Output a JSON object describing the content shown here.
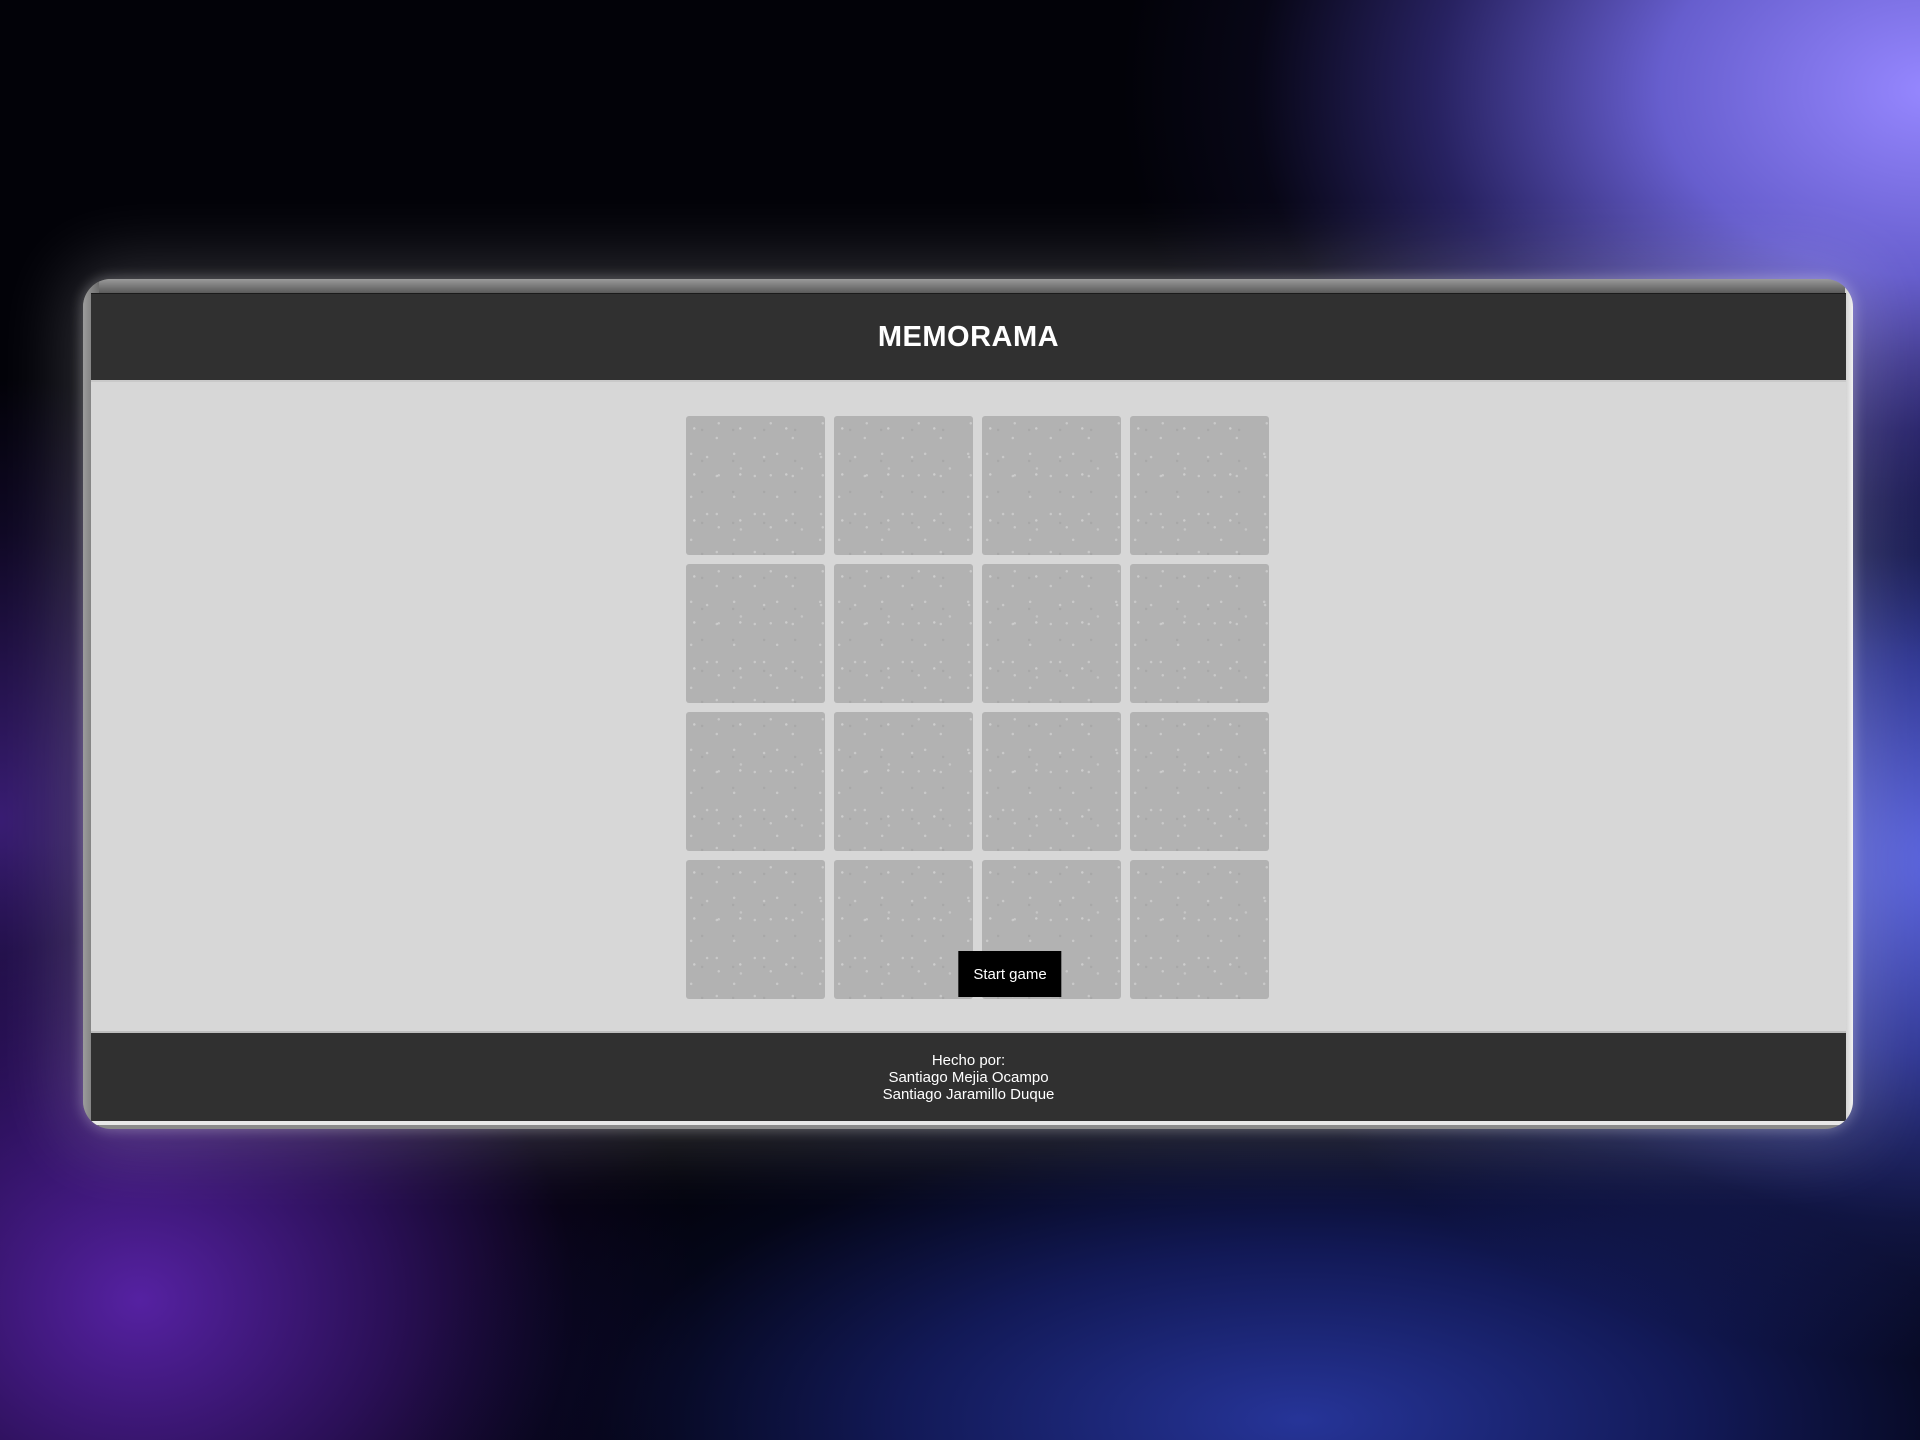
{
  "header": {
    "title": "MEMORAMA"
  },
  "board": {
    "rows": 4,
    "columns": 4,
    "cards": [
      {
        "state": "face-down"
      },
      {
        "state": "face-down"
      },
      {
        "state": "face-down"
      },
      {
        "state": "face-down"
      },
      {
        "state": "face-down"
      },
      {
        "state": "face-down"
      },
      {
        "state": "face-down"
      },
      {
        "state": "face-down"
      },
      {
        "state": "face-down"
      },
      {
        "state": "face-down"
      },
      {
        "state": "face-down"
      },
      {
        "state": "face-down"
      },
      {
        "state": "face-down"
      },
      {
        "state": "face-down"
      },
      {
        "state": "face-down"
      },
      {
        "state": "face-down"
      }
    ],
    "card_back_color": "#b2b2b2"
  },
  "start_button": {
    "label": "Start game"
  },
  "footer": {
    "made_by_label": "Hecho por:",
    "authors": [
      "Santiago Mejia Ocampo",
      "Santiago Jaramillo Duque"
    ]
  },
  "colors": {
    "header_bg": "#303030",
    "page_bg": "#d7d7d7",
    "button_bg": "#000000",
    "text_light": "#ffffff"
  }
}
